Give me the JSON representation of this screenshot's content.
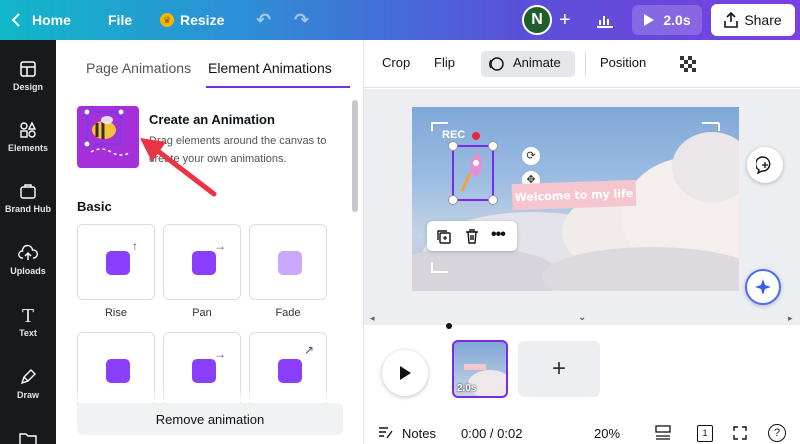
{
  "topbar": {
    "home_label": "Home",
    "file_label": "File",
    "resize_label": "Resize",
    "avatar_initial": "N",
    "duration_label": "2.0s",
    "share_label": "Share"
  },
  "leftnav": {
    "items": [
      {
        "label": "Design"
      },
      {
        "label": "Elements"
      },
      {
        "label": "Brand Hub"
      },
      {
        "label": "Uploads"
      },
      {
        "label": "Text"
      },
      {
        "label": "Draw"
      }
    ]
  },
  "panel": {
    "tabs": [
      {
        "label": "Page Animations",
        "active": false
      },
      {
        "label": "Element Animations",
        "active": true
      }
    ],
    "create": {
      "title": "Create an Animation",
      "description": "Drag elements around the canvas to create your own animations."
    },
    "section_title": "Basic",
    "animations": [
      {
        "label": "Rise"
      },
      {
        "label": "Pan"
      },
      {
        "label": "Fade"
      }
    ],
    "remove_label": "Remove animation"
  },
  "toolbar": {
    "crop": "Crop",
    "flip": "Flip",
    "animate": "Animate",
    "position": "Position"
  },
  "canvas": {
    "rec_label": "REC",
    "welcome_text": "Welcome to my life"
  },
  "timeline": {
    "page_duration": "2.0s",
    "add_symbol": "+"
  },
  "bottombar": {
    "notes_label": "Notes",
    "time_label": "0:00 / 0:02",
    "zoom_label": "20%",
    "page_count": "1",
    "help_symbol": "?"
  },
  "colors": {
    "accent": "#7d2ae8",
    "arrow": "#ea3344",
    "sidebar_bg": "#18191b"
  }
}
